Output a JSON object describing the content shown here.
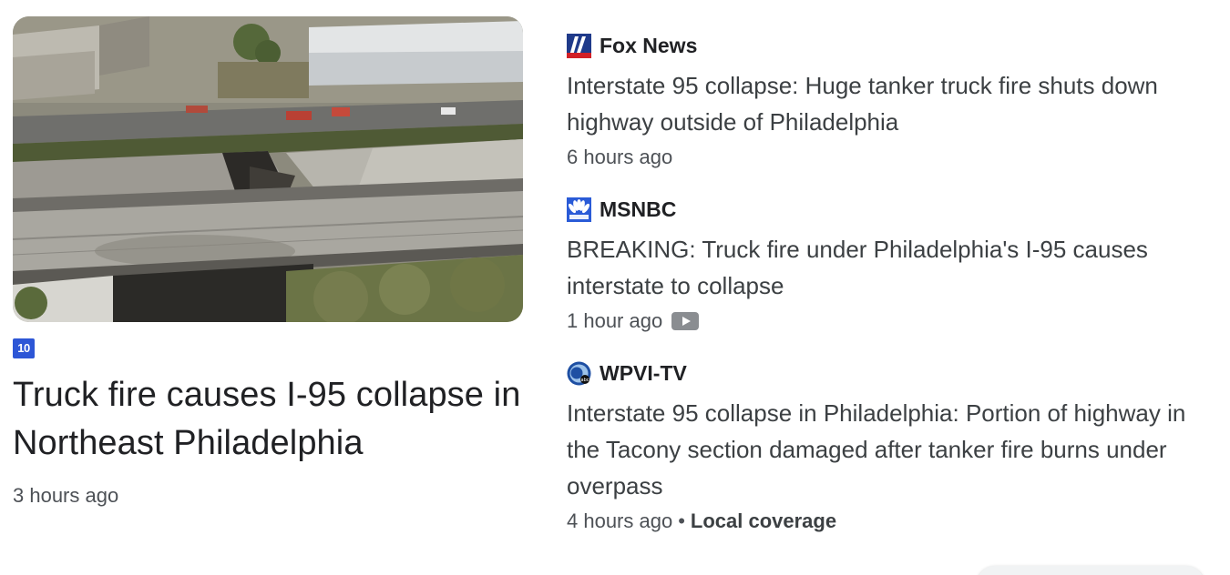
{
  "featured": {
    "source_logo_text": "10",
    "source_logo_icon": "nbc10-logo-icon",
    "title": "Truck fire causes I-95 collapse in Northeast Philadelphia",
    "time": "3 hours ago"
  },
  "stories": [
    {
      "source": "Fox News",
      "icon": "fox-news-logo-icon",
      "headline": "Interstate 95 collapse: Huge tanker truck fire shuts down highway outside of Philadelphia",
      "time": "6 hours ago"
    },
    {
      "source": "MSNBC",
      "icon": "msnbc-peacock-logo-icon",
      "headline": "BREAKING: Truck fire under Philadelphia's I-95 causes interstate to collapse",
      "time": "1 hour ago",
      "badge_icon": "video-play-icon"
    },
    {
      "source": "WPVI-TV",
      "icon": "abc-6-logo-icon",
      "headline": "Interstate 95 collapse in Philadelphia: Portion of highway in the Tacony section damaged after tanker fire burns under overpass",
      "time": "4 hours ago",
      "separator": "•",
      "tag": "Local coverage"
    }
  ],
  "colors": {
    "headline": "#3c4043",
    "meta": "#4d5156",
    "nbc10_blue": "#2d56d6",
    "fox_blue": "#1f3a8a",
    "fox_red": "#d11f26"
  }
}
